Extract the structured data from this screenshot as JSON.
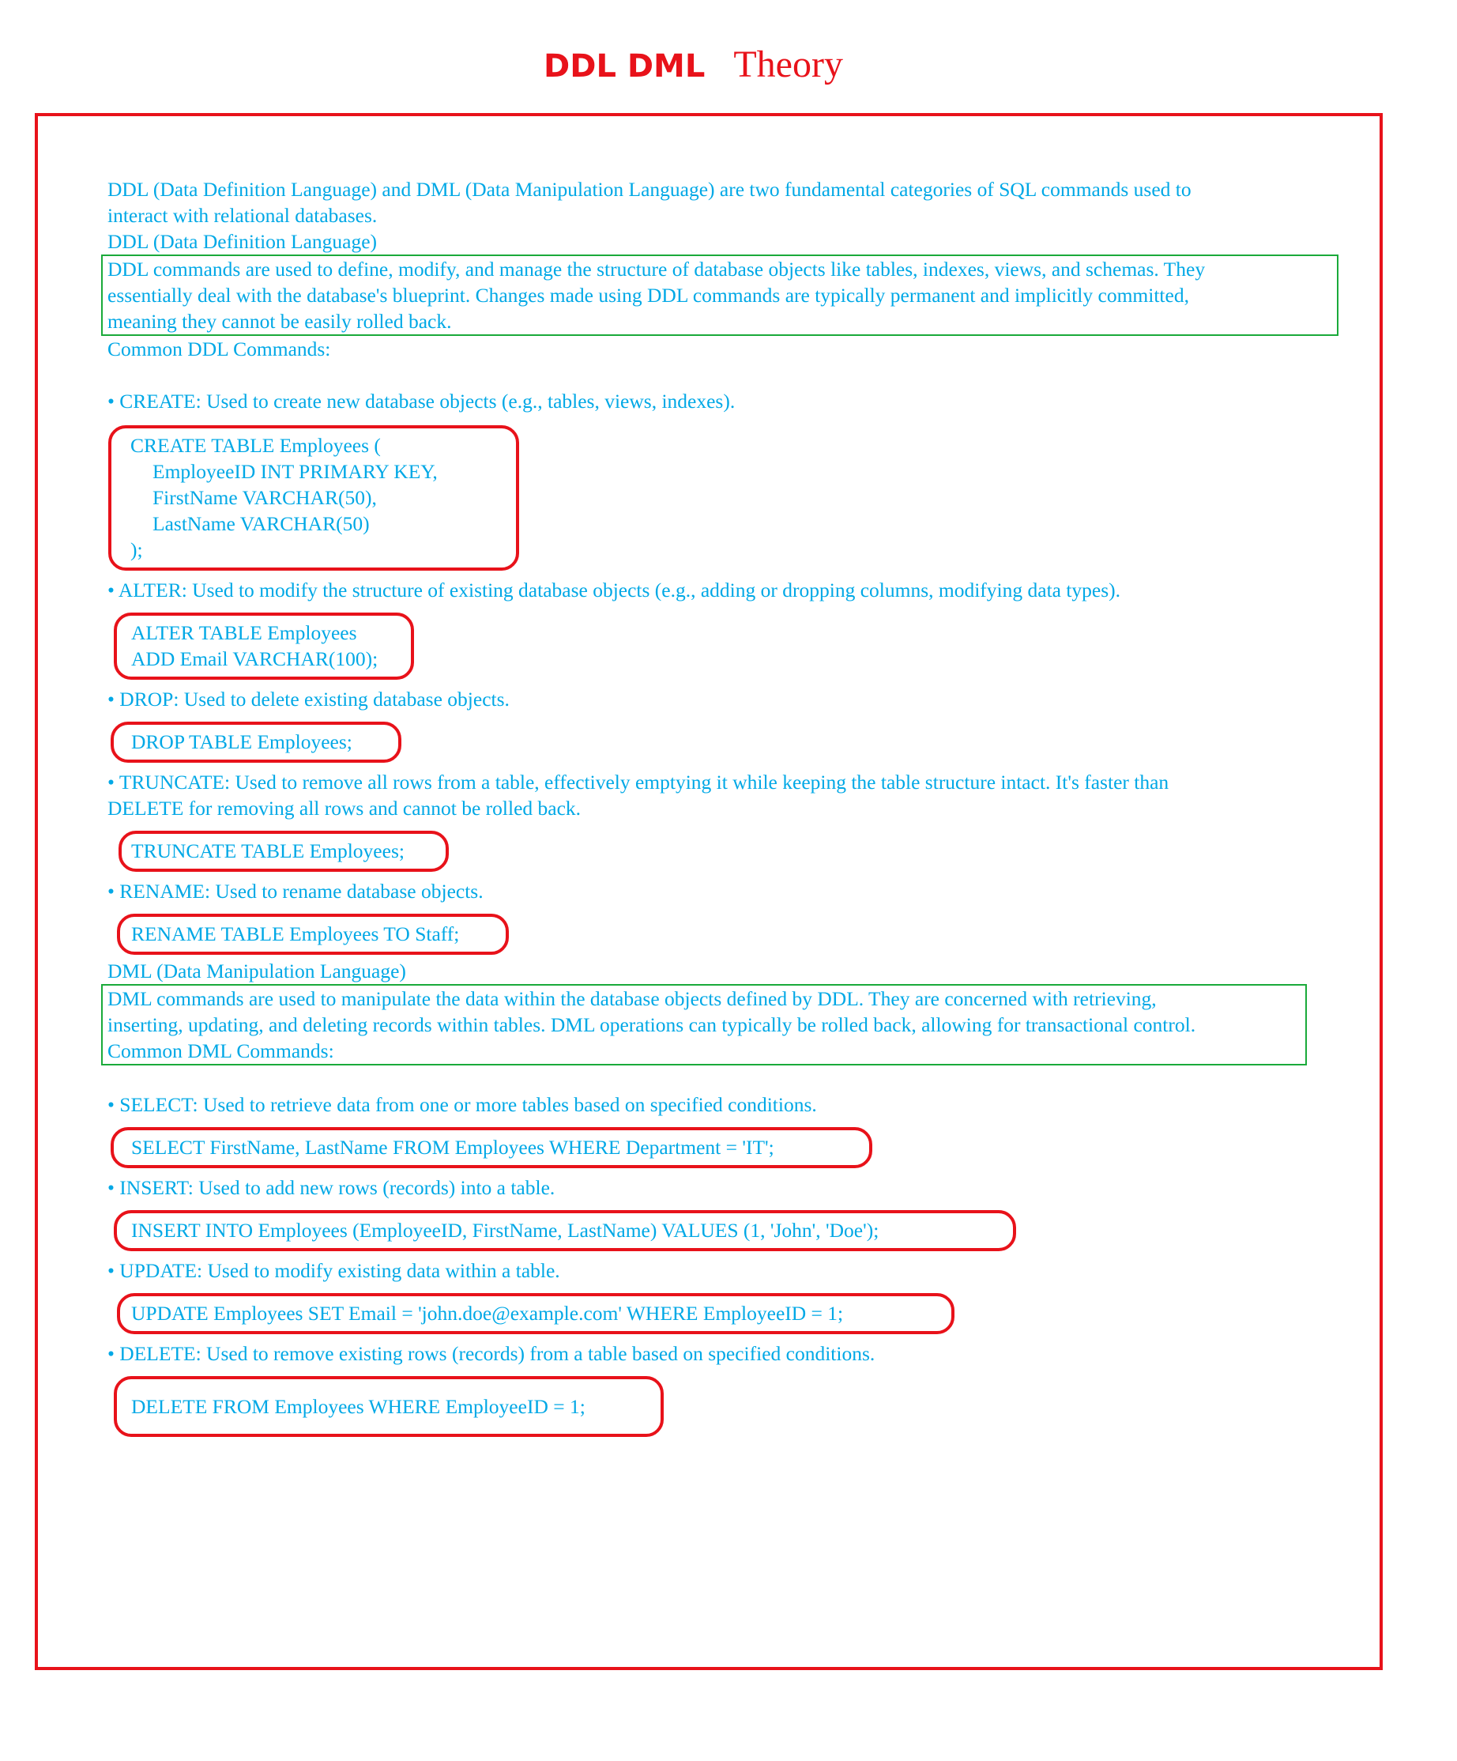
{
  "title": {
    "part1": "DDL DML",
    "part2": "Theory"
  },
  "intro": {
    "line1": "DDL (Data Definition Language) and DML (Data Manipulation Language) are two fundamental categories of SQL commands used to",
    "line2": "interact with relational databases."
  },
  "ddl": {
    "heading": "DDL (Data Definition Language)",
    "desc_line1": "DDL commands are used to define, modify, and manage the structure of database objects like tables, indexes, views, and schemas. They",
    "desc_line2": "essentially deal with the database's blueprint. Changes made using DDL commands are typically permanent and implicitly committed,",
    "desc_line3": "meaning they cannot be easily rolled back.",
    "common": "Common DDL Commands:",
    "create_bullet": "• CREATE: Used to create new database objects (e.g., tables, views, indexes).",
    "create_code": {
      "l1": "CREATE TABLE Employees (",
      "l2": "EmployeeID INT PRIMARY KEY,",
      "l3": "FirstName VARCHAR(50),",
      "l4": "LastName VARCHAR(50)",
      "l5": ");"
    },
    "alter_bullet": "• ALTER: Used to modify the structure of existing database objects (e.g., adding or dropping columns, modifying data types).",
    "alter_code": {
      "l1": "ALTER TABLE Employees",
      "l2": "ADD Email VARCHAR(100);"
    },
    "drop_bullet": "• DROP: Used to delete existing database objects.",
    "drop_code": "DROP TABLE Employees;",
    "truncate_bullet_l1": "• TRUNCATE: Used to remove all rows from a table, effectively emptying it while keeping the table structure intact. It's faster than",
    "truncate_bullet_l2": "DELETE for removing all rows and cannot be rolled back.",
    "truncate_code": "TRUNCATE TABLE Employees;",
    "rename_bullet": "• RENAME: Used to rename database objects.",
    "rename_code": "RENAME TABLE Employees TO Staff;"
  },
  "dml": {
    "heading": "DML (Data Manipulation Language)",
    "desc_line1": "DML commands are used to manipulate the data within the database objects defined by DDL. They are concerned with retrieving,",
    "desc_line2": "inserting, updating, and deleting records within tables. DML operations can typically be rolled back, allowing for transactional control.",
    "common": "Common DML Commands:",
    "select_bullet": "• SELECT: Used to retrieve data from one or more tables based on specified conditions.",
    "select_code": "SELECT FirstName, LastName FROM Employees WHERE Department = 'IT';",
    "insert_bullet": "• INSERT: Used to add new rows (records) into a table.",
    "insert_code": "INSERT INTO Employees (EmployeeID, FirstName, LastName) VALUES (1, 'John', 'Doe');",
    "update_bullet": "• UPDATE: Used to modify existing data within a table.",
    "update_code": "UPDATE Employees SET Email = 'john.doe@example.com' WHERE EmployeeID = 1;",
    "delete_bullet": "• DELETE: Used to remove existing rows (records) from a table based on specified conditions.",
    "delete_code": "DELETE FROM Employees WHERE EmployeeID = 1;"
  },
  "colors": {
    "text": "#00a8e6",
    "title": "#e8121a",
    "frame": "#e8121a",
    "code_border": "#e8121a",
    "definition_border": "#1aaa3a"
  }
}
